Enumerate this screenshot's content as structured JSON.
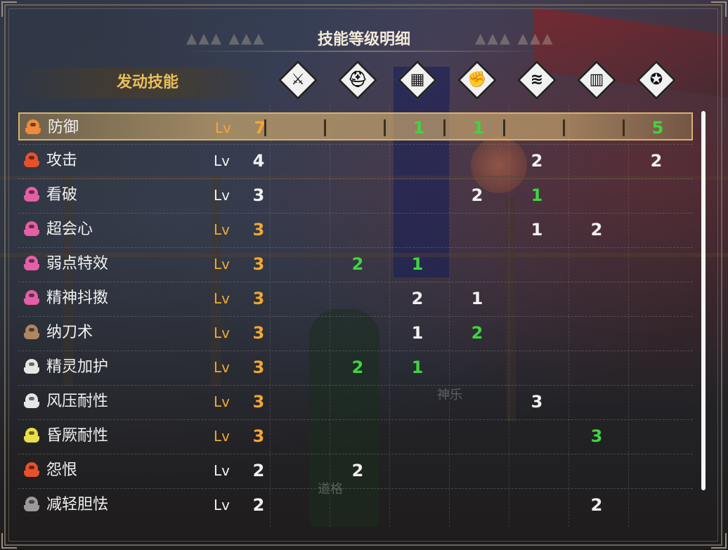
{
  "title": "技能等级明细",
  "header": {
    "label": "发动技能",
    "slots": [
      {
        "name": "weapon",
        "icon": "sword-icon"
      },
      {
        "name": "head",
        "icon": "helmet-icon"
      },
      {
        "name": "chest",
        "icon": "chest-armor-icon"
      },
      {
        "name": "arms",
        "icon": "gauntlet-icon"
      },
      {
        "name": "waist",
        "icon": "coil-icon"
      },
      {
        "name": "legs",
        "icon": "greaves-icon"
      },
      {
        "name": "talisman",
        "icon": "talisman-icon"
      }
    ]
  },
  "background_labels": [
    "神乐",
    "道格"
  ],
  "colors": {
    "orange": "#f2a733",
    "white": "#f1f1f1",
    "green": "#3ed63e",
    "gold_bar": "#d9b26e"
  },
  "skills": [
    {
      "name": "防御",
      "lv_label": "Lv",
      "level": "7",
      "icon_color": "#f08a3c",
      "lv_color": "orange",
      "selected": true,
      "cells": [
        {
          "v": "",
          "c": "white"
        },
        {
          "v": "",
          "c": "white"
        },
        {
          "v": "1",
          "c": "green"
        },
        {
          "v": "1",
          "c": "green"
        },
        {
          "v": "",
          "c": "white"
        },
        {
          "v": "",
          "c": "white"
        },
        {
          "v": "5",
          "c": "green"
        }
      ]
    },
    {
      "name": "攻击",
      "lv_label": "Lv",
      "level": "4",
      "icon_color": "#e8502a",
      "lv_color": "white",
      "selected": false,
      "cells": [
        {
          "v": "",
          "c": "white"
        },
        {
          "v": "",
          "c": "white"
        },
        {
          "v": "",
          "c": "white"
        },
        {
          "v": "",
          "c": "white"
        },
        {
          "v": "2",
          "c": "white"
        },
        {
          "v": "",
          "c": "white"
        },
        {
          "v": "2",
          "c": "white"
        }
      ]
    },
    {
      "name": "看破",
      "lv_label": "Lv",
      "level": "3",
      "icon_color": "#e45fa5",
      "lv_color": "white",
      "selected": false,
      "cells": [
        {
          "v": "",
          "c": "white"
        },
        {
          "v": "",
          "c": "white"
        },
        {
          "v": "",
          "c": "white"
        },
        {
          "v": "2",
          "c": "white"
        },
        {
          "v": "1",
          "c": "green"
        },
        {
          "v": "",
          "c": "white"
        },
        {
          "v": "",
          "c": "white"
        }
      ]
    },
    {
      "name": "超会心",
      "lv_label": "Lv",
      "level": "3",
      "icon_color": "#e45fa5",
      "lv_color": "orange",
      "selected": false,
      "cells": [
        {
          "v": "",
          "c": "white"
        },
        {
          "v": "",
          "c": "white"
        },
        {
          "v": "",
          "c": "white"
        },
        {
          "v": "",
          "c": "white"
        },
        {
          "v": "1",
          "c": "white"
        },
        {
          "v": "2",
          "c": "white"
        },
        {
          "v": "",
          "c": "white"
        }
      ]
    },
    {
      "name": "弱点特效",
      "lv_label": "Lv",
      "level": "3",
      "icon_color": "#e45fa5",
      "lv_color": "orange",
      "selected": false,
      "cells": [
        {
          "v": "",
          "c": "white"
        },
        {
          "v": "2",
          "c": "green"
        },
        {
          "v": "1",
          "c": "green"
        },
        {
          "v": "",
          "c": "white"
        },
        {
          "v": "",
          "c": "white"
        },
        {
          "v": "",
          "c": "white"
        },
        {
          "v": "",
          "c": "white"
        }
      ]
    },
    {
      "name": "精神抖擞",
      "lv_label": "Lv",
      "level": "3",
      "icon_color": "#e45fa5",
      "lv_color": "orange",
      "selected": false,
      "cells": [
        {
          "v": "",
          "c": "white"
        },
        {
          "v": "",
          "c": "white"
        },
        {
          "v": "2",
          "c": "white"
        },
        {
          "v": "1",
          "c": "white"
        },
        {
          "v": "",
          "c": "white"
        },
        {
          "v": "",
          "c": "white"
        },
        {
          "v": "",
          "c": "white"
        }
      ]
    },
    {
      "name": "纳刀术",
      "lv_label": "Lv",
      "level": "3",
      "icon_color": "#b08560",
      "lv_color": "orange",
      "selected": false,
      "cells": [
        {
          "v": "",
          "c": "white"
        },
        {
          "v": "",
          "c": "white"
        },
        {
          "v": "1",
          "c": "white"
        },
        {
          "v": "2",
          "c": "green"
        },
        {
          "v": "",
          "c": "white"
        },
        {
          "v": "",
          "c": "white"
        },
        {
          "v": "",
          "c": "white"
        }
      ]
    },
    {
      "name": "精灵加护",
      "lv_label": "Lv",
      "level": "3",
      "icon_color": "#e6e6e6",
      "lv_color": "orange",
      "selected": false,
      "cells": [
        {
          "v": "",
          "c": "white"
        },
        {
          "v": "2",
          "c": "green"
        },
        {
          "v": "1",
          "c": "green"
        },
        {
          "v": "",
          "c": "white"
        },
        {
          "v": "",
          "c": "white"
        },
        {
          "v": "",
          "c": "white"
        },
        {
          "v": "",
          "c": "white"
        }
      ]
    },
    {
      "name": "风压耐性",
      "lv_label": "Lv",
      "level": "3",
      "icon_color": "#e6e6e6",
      "lv_color": "orange",
      "selected": false,
      "cells": [
        {
          "v": "",
          "c": "white"
        },
        {
          "v": "",
          "c": "white"
        },
        {
          "v": "",
          "c": "white"
        },
        {
          "v": "",
          "c": "white"
        },
        {
          "v": "3",
          "c": "white"
        },
        {
          "v": "",
          "c": "white"
        },
        {
          "v": "",
          "c": "white"
        }
      ]
    },
    {
      "name": "昏厥耐性",
      "lv_label": "Lv",
      "level": "3",
      "icon_color": "#e8e048",
      "lv_color": "orange",
      "selected": false,
      "cells": [
        {
          "v": "",
          "c": "white"
        },
        {
          "v": "",
          "c": "white"
        },
        {
          "v": "",
          "c": "white"
        },
        {
          "v": "",
          "c": "white"
        },
        {
          "v": "",
          "c": "white"
        },
        {
          "v": "3",
          "c": "green"
        },
        {
          "v": "",
          "c": "white"
        }
      ]
    },
    {
      "name": "怨恨",
      "lv_label": "Lv",
      "level": "2",
      "icon_color": "#e8502a",
      "lv_color": "white",
      "selected": false,
      "cells": [
        {
          "v": "",
          "c": "white"
        },
        {
          "v": "2",
          "c": "white"
        },
        {
          "v": "",
          "c": "white"
        },
        {
          "v": "",
          "c": "white"
        },
        {
          "v": "",
          "c": "white"
        },
        {
          "v": "",
          "c": "white"
        },
        {
          "v": "",
          "c": "white"
        }
      ]
    },
    {
      "name": "减轻胆怯",
      "lv_label": "Lv",
      "level": "2",
      "icon_color": "#9a9a9a",
      "lv_color": "white",
      "selected": false,
      "cells": [
        {
          "v": "",
          "c": "white"
        },
        {
          "v": "",
          "c": "white"
        },
        {
          "v": "",
          "c": "white"
        },
        {
          "v": "",
          "c": "white"
        },
        {
          "v": "",
          "c": "white"
        },
        {
          "v": "2",
          "c": "white"
        },
        {
          "v": "",
          "c": "white"
        }
      ]
    }
  ]
}
